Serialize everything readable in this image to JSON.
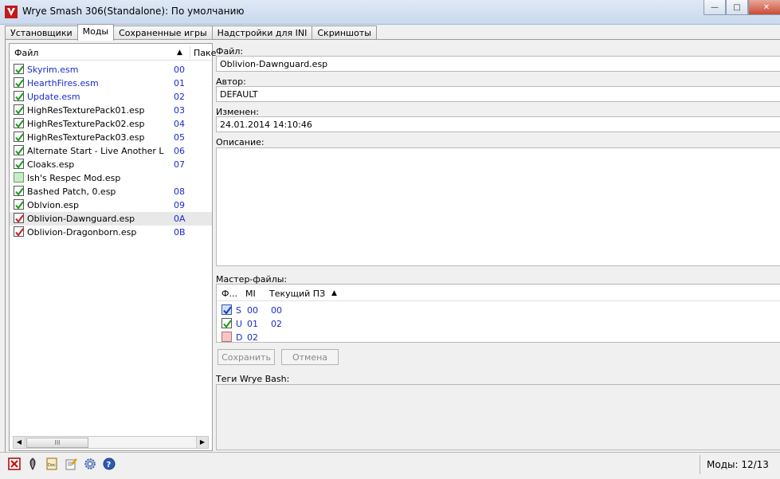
{
  "window": {
    "title": "Wrye Smash 306(Standalone): По умолчанию",
    "minimize": "—",
    "maximize": "□",
    "close": "✕"
  },
  "tabs": [
    {
      "label": "Установщики"
    },
    {
      "label": "Моды"
    },
    {
      "label": "Сохраненные игры"
    },
    {
      "label": "Надстройки для INI"
    },
    {
      "label": "Скриншоты"
    }
  ],
  "active_tab": "Моды",
  "mods_list": {
    "headers": {
      "file": "Файл",
      "sort_arrow": "▲",
      "package": "Паке"
    },
    "items": [
      {
        "name": "Skyrim.esm",
        "index": "00",
        "checked": true,
        "color": "blue"
      },
      {
        "name": "HearthFires.esm",
        "index": "01",
        "checked": true,
        "color": "blue"
      },
      {
        "name": "Update.esm",
        "index": "02",
        "checked": true,
        "color": "blue"
      },
      {
        "name": "HighResTexturePack01.esp",
        "index": "03",
        "checked": true,
        "color": "black"
      },
      {
        "name": "HighResTexturePack02.esp",
        "index": "04",
        "checked": true,
        "color": "black"
      },
      {
        "name": "HighResTexturePack03.esp",
        "index": "05",
        "checked": true,
        "color": "black"
      },
      {
        "name": "Alternate Start - Live Another Life.esp",
        "index": "06",
        "checked": true,
        "color": "black"
      },
      {
        "name": "Cloaks.esp",
        "index": "07",
        "checked": true,
        "color": "black"
      },
      {
        "name": "Ish's Respec Mod.esp",
        "index": "",
        "checked": false,
        "color": "black"
      },
      {
        "name": "Bashed Patch, 0.esp",
        "index": "08",
        "checked": true,
        "color": "black"
      },
      {
        "name": "Oblvion.esp",
        "index": "09",
        "checked": true,
        "color": "black"
      },
      {
        "name": "Oblivion-Dawnguard.esp",
        "index": "0A",
        "checked": true,
        "color": "black",
        "error": true,
        "selected": true
      },
      {
        "name": "Oblivion-Dragonborn.esp",
        "index": "0B",
        "checked": true,
        "color": "black",
        "error": true
      }
    ],
    "scroll_grip": "III"
  },
  "details": {
    "file_label": "Файл:",
    "file_value": "Oblivion-Dawnguard.esp",
    "author_label": "Автор:",
    "author_value": "DEFAULT",
    "modified_label": "Изменен:",
    "modified_value": "24.01.2014 14:10:46",
    "description_label": "Описание:",
    "description_value": "",
    "masters_label": "Мастер-файлы:",
    "masters_headers": {
      "file": "Ф...",
      "mi": "MI",
      "current": "Текущий ПЗ",
      "sort_arrow": "▲"
    },
    "masters": [
      {
        "file": "S",
        "mi": "00",
        "current": "00",
        "state": "blue"
      },
      {
        "file": "U",
        "mi": "01",
        "current": "02",
        "state": "ok"
      },
      {
        "file": "D",
        "mi": "02",
        "current": "",
        "state": "missing"
      }
    ],
    "save_button": "Сохранить",
    "cancel_button": "Отмена",
    "tags_label": "Теги Wrye Bash:"
  },
  "statusbar": {
    "mods_count": "Моды: 12/13"
  }
}
